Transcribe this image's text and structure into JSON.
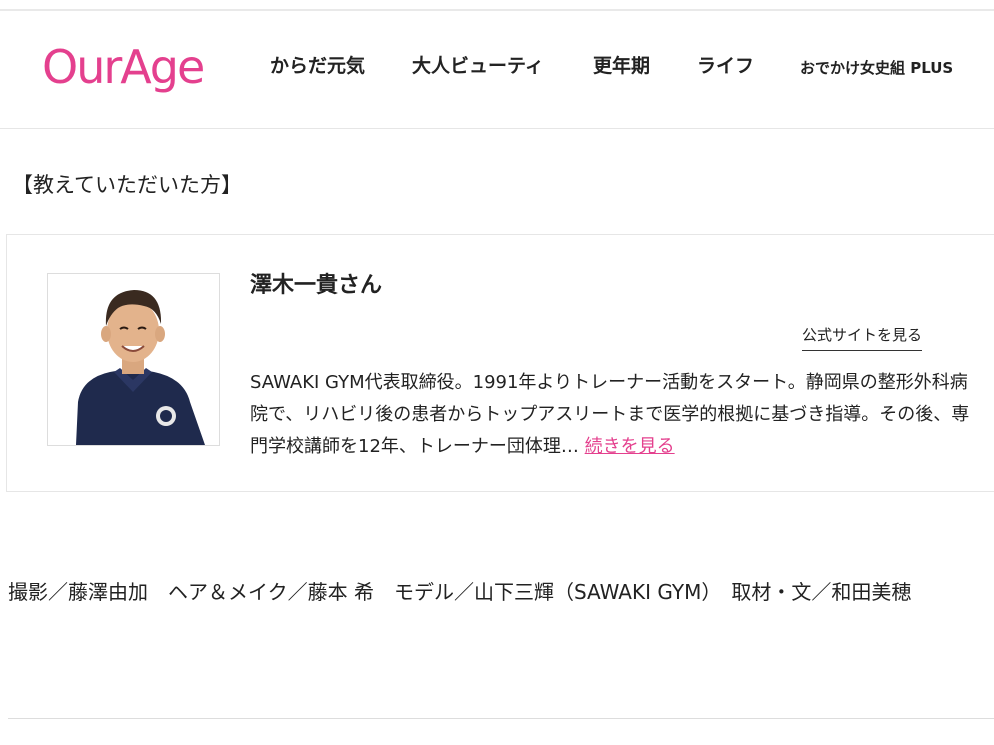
{
  "header": {
    "logo": "OurAge",
    "brand_color": "#e4408e",
    "nav": [
      {
        "label": "からだ元気"
      },
      {
        "label": "大人ビューティ"
      },
      {
        "label": "更年期"
      },
      {
        "label": "ライフ"
      },
      {
        "label": "おでかけ女史組 PLUS"
      }
    ]
  },
  "section": {
    "label": "【教えていただいた方】"
  },
  "profile": {
    "name": "澤木一貴さん",
    "official_site_link": "公式サイトを見る",
    "bio": "SAWAKI GYM代表取締役。1991年よりトレーナー活動をスタート。静岡県の整形外科病院で、リハビリ後の患者からトップアスリートまで医学的根拠に基づき指導。その後、専門学校講師を12年、トレーナー団体理…",
    "more_link": "続きを見る",
    "photo_icon": "person-photo"
  },
  "credits": {
    "text": "撮影／藤澤由加　ヘア＆メイク／藤本 希　モデル／山下三輝（SAWAKI GYM）　取材・文／和田美穂"
  }
}
